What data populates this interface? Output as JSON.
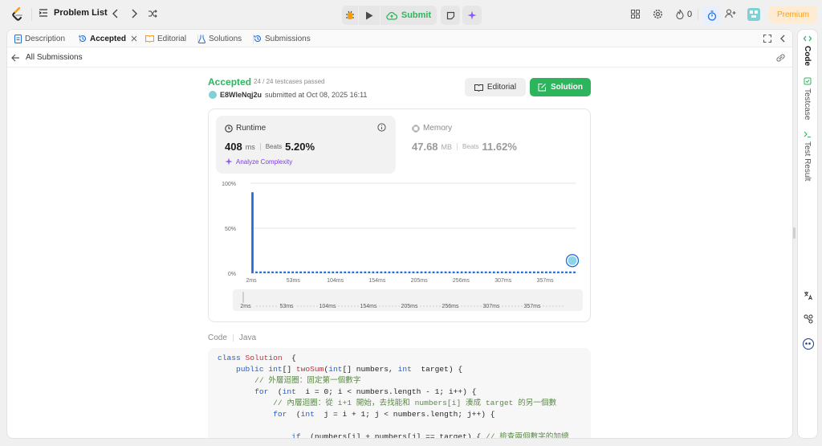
{
  "topbar": {
    "problem_list": "Problem List",
    "submit": "Submit",
    "streak_count": "0",
    "premium": "Premium"
  },
  "tabs": {
    "description": "Description",
    "accepted": "Accepted",
    "editorial": "Editorial",
    "solutions": "Solutions",
    "submissions": "Submissions"
  },
  "subnav": {
    "back": "All Submissions"
  },
  "result": {
    "status": "Accepted",
    "testcases": "24 / 24 testcases passed",
    "user": "E8WleNqj2u",
    "submitted": "submitted at Oct 08, 2025 16:11",
    "editorial_btn": "Editorial",
    "solution_btn": "Solution"
  },
  "runtime": {
    "label": "Runtime",
    "value": "408",
    "unit": "ms",
    "beats_label": "Beats",
    "beats": "5.20%",
    "analyze": "Analyze Complexity"
  },
  "memory": {
    "label": "Memory",
    "value": "47.68",
    "unit": "MB",
    "beats_label": "Beats",
    "beats": "11.62%"
  },
  "chart_data": {
    "type": "bar",
    "ylim": [
      0,
      100
    ],
    "y_ticks": [
      "100%",
      "50%",
      "0%"
    ],
    "x_ticks": [
      "2ms",
      "53ms",
      "104ms",
      "154ms",
      "205ms",
      "256ms",
      "307ms",
      "357ms"
    ],
    "nav_ticks": [
      "2ms",
      "53ms",
      "104ms",
      "154ms",
      "205ms",
      "256ms",
      "307ms",
      "357ms"
    ],
    "values": [
      90,
      2,
      2,
      2,
      2,
      2,
      2,
      2,
      2,
      2,
      2,
      2,
      2,
      2,
      2,
      2,
      2,
      2,
      2,
      2,
      2,
      2,
      2,
      2,
      2,
      2,
      2,
      2,
      2,
      2,
      2,
      2,
      2,
      2,
      2,
      2,
      2,
      2,
      2,
      2,
      2,
      2,
      2,
      2,
      2,
      2,
      2,
      2,
      2,
      2,
      2,
      2,
      2,
      2,
      2,
      2,
      2,
      2,
      2,
      2,
      2,
      2,
      2,
      2,
      2,
      2,
      2,
      2,
      2,
      2,
      2,
      2,
      2,
      2,
      2,
      2,
      2,
      2,
      2,
      2,
      2
    ],
    "color": "#1e6fd9"
  },
  "code": {
    "label": "Code",
    "language": "Java",
    "lines": [
      [
        [
          "kw",
          "class "
        ],
        [
          "cls",
          "Solution"
        ],
        [
          "",
          "  {"
        ]
      ],
      [
        [
          "",
          "    "
        ],
        [
          "kw",
          "public int"
        ],
        [
          "",
          "[] "
        ],
        [
          "cls",
          "twoSum"
        ],
        [
          "",
          "("
        ],
        [
          "kw",
          "int"
        ],
        [
          "",
          "[] numbers, "
        ],
        [
          "kw",
          "int"
        ],
        [
          "",
          "  target) {"
        ]
      ],
      [
        [
          "",
          "        "
        ],
        [
          "cm",
          "// 外層迴圈：固定第一個數字"
        ]
      ],
      [
        [
          "",
          "        "
        ],
        [
          "kw",
          "for"
        ],
        [
          "",
          "  ("
        ],
        [
          "kw",
          "int"
        ],
        [
          "",
          "  i = 0; i < numbers.length - 1; i++) {"
        ]
      ],
      [
        [
          "",
          "            "
        ],
        [
          "cm",
          "// 內層迴圈：從 i+1 開始，去找能和 numbers[i] 湊成 target 的另一個數"
        ]
      ],
      [
        [
          "",
          "            "
        ],
        [
          "kw",
          "for"
        ],
        [
          "",
          "  ("
        ],
        [
          "kw",
          "int"
        ],
        [
          "",
          "  j = i + 1; j < numbers.length; j++) {"
        ]
      ],
      [
        [
          "",
          ""
        ]
      ],
      [
        [
          "",
          "                "
        ],
        [
          "kw",
          "if"
        ],
        [
          "",
          "  (numbers[i] + numbers[j] == target) { "
        ],
        [
          "cm",
          "// 檢查兩個數字的加總"
        ]
      ]
    ]
  },
  "rail": {
    "code": "Code",
    "testcase": "Testcase",
    "test_result": "Test Result"
  },
  "colors": {
    "accepted": "#2db55d",
    "accent": "#1e6fd9",
    "premium": "#ffa116",
    "purple": "#8b5cf6"
  }
}
